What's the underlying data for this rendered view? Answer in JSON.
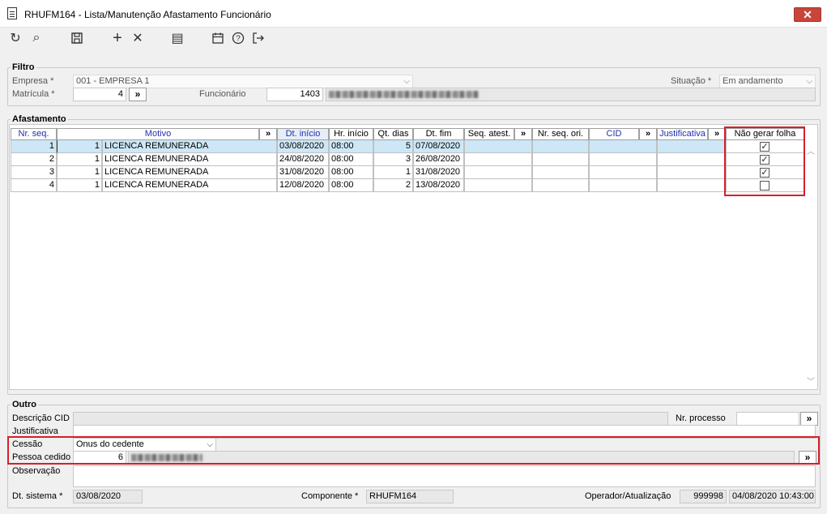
{
  "window": {
    "title": "RHUFM164 - Lista/Manutenção Afastamento Funcionário",
    "close_label": "✕"
  },
  "toolbar": [
    {
      "name": "refresh-icon",
      "glyph": "↻"
    },
    {
      "name": "search-icon",
      "glyph": "⌕"
    },
    {
      "name": "save-icon",
      "glyph": "🖫"
    },
    {
      "name": "add-icon",
      "glyph": "+"
    },
    {
      "name": "delete-icon",
      "glyph": "✕"
    },
    {
      "name": "list-icon",
      "glyph": "▤"
    },
    {
      "name": "calendar-icon",
      "glyph": "▦"
    },
    {
      "name": "help-icon",
      "glyph": "?"
    },
    {
      "name": "exit-icon",
      "glyph": "⇥"
    }
  ],
  "filtro": {
    "legend": "Filtro",
    "empresa_label": "Empresa *",
    "empresa_value": "001 - EMPRESA 1",
    "situacao_label": "Situação *",
    "situacao_value": "Em andamento",
    "matricula_label": "Matrícula *",
    "matricula_value": "4",
    "lookup_label": "»",
    "funcionario_label": "Funcionário",
    "funcionario_value": "1403"
  },
  "afastamento": {
    "legend": "Afastamento",
    "headers": {
      "nr_seq": "Nr. seq.",
      "motivo": "Motivo",
      "motivo_more": "»",
      "dt_inicio": "Dt. início",
      "hr_inicio": "Hr. início",
      "qt_dias": "Qt. dias",
      "dt_fim": "Dt. fim",
      "seq_atest": "Seq. atest.",
      "seq_atest_more": "»",
      "nr_seq_ori": "Nr. seq. ori.",
      "cid": "CID",
      "cid_more": "»",
      "justificativa": "Justificativa",
      "justificativa_more": "»",
      "nao_gerar_folha": "Não gerar folha"
    },
    "rows": [
      {
        "nr_seq": "1",
        "motivo_cod": "1",
        "motivo": "LICENCA REMUNERADA",
        "dt_inicio": "03/08/2020",
        "hr_inicio": "08:00",
        "qt_dias": "5",
        "dt_fim": "07/08/2020",
        "nao_gerar_folha": true
      },
      {
        "nr_seq": "2",
        "motivo_cod": "1",
        "motivo": "LICENCA REMUNERADA",
        "dt_inicio": "24/08/2020",
        "hr_inicio": "08:00",
        "qt_dias": "3",
        "dt_fim": "26/08/2020",
        "nao_gerar_folha": true
      },
      {
        "nr_seq": "3",
        "motivo_cod": "1",
        "motivo": "LICENCA REMUNERADA",
        "dt_inicio": "31/08/2020",
        "hr_inicio": "08:00",
        "qt_dias": "1",
        "dt_fim": "31/08/2020",
        "nao_gerar_folha": true
      },
      {
        "nr_seq": "4",
        "motivo_cod": "1",
        "motivo": "LICENCA REMUNERADA",
        "dt_inicio": "12/08/2020",
        "hr_inicio": "08:00",
        "qt_dias": "2",
        "dt_fim": "13/08/2020",
        "nao_gerar_folha": false
      }
    ]
  },
  "outro": {
    "legend": "Outro",
    "descricao_cid_label": "Descrição CID",
    "nr_processo_label": "Nr. processo",
    "justificativa_label": "Justificativa",
    "cessao_label": "Cessão",
    "cessao_value": "Onus do cedente",
    "pessoa_cedido_label": "Pessoa cedido",
    "pessoa_cedido_value": "6",
    "observacao_label": "Observação",
    "dt_sistema_label": "Dt. sistema *",
    "dt_sistema_value": "03/08/2020",
    "componente_label": "Componente *",
    "componente_value": "RHUFM164",
    "operador_label": "Operador/Atualização",
    "operador_value": "999998",
    "atualizacao_value": "04/08/2020 10:43:00"
  },
  "colors": {
    "highlight_box": "#d3202a",
    "header_link": "#1f2fb0",
    "selected_row": "#cde7f7"
  }
}
